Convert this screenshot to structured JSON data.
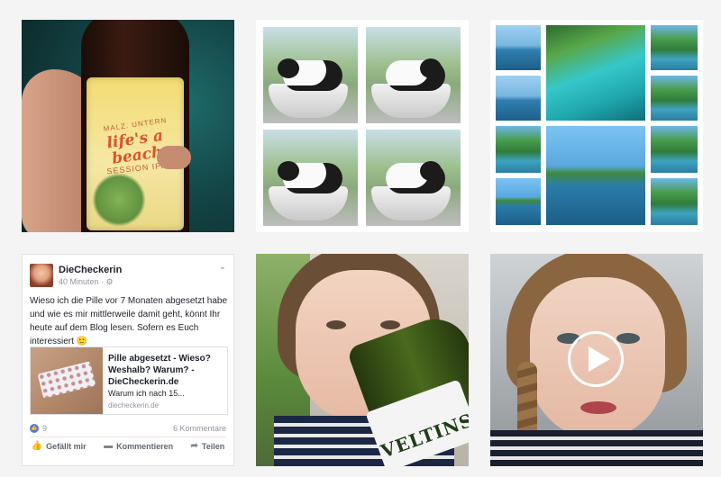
{
  "beer_post": {
    "label_top": "MALZ. UNTERN",
    "label_main": "life's a beach",
    "label_style": "SESSION IPA"
  },
  "facebook_post": {
    "author": "DieCheckerin",
    "time": "40 Minuten",
    "audience_icon": "globe-icon",
    "text": "Wieso ich die Pille vor 7 Monaten abgesetzt habe und wie es mir mittlerweile damit geht, könnt Ihr heute auf dem Blog lesen. Sofern es Euch interessiert 🙂",
    "link_title": "Pille abgesetzt - Wieso? Weshalb? Warum? - DieCheckerin.de",
    "link_description": "Warum ich nach 15...",
    "link_domain": "diecheckerin.de",
    "likes_count": "9",
    "comments_count": "6 Kommentare",
    "actions": {
      "like": "Gefällt mir",
      "comment": "Kommentieren",
      "share": "Teilen"
    }
  },
  "selfie_post": {
    "bottle_brand": "VELTINS"
  },
  "video_post": {
    "play_icon": "play-icon"
  },
  "colors": {
    "facebook_blue": "#4c7ad8",
    "background": "#f4f4f4"
  }
}
